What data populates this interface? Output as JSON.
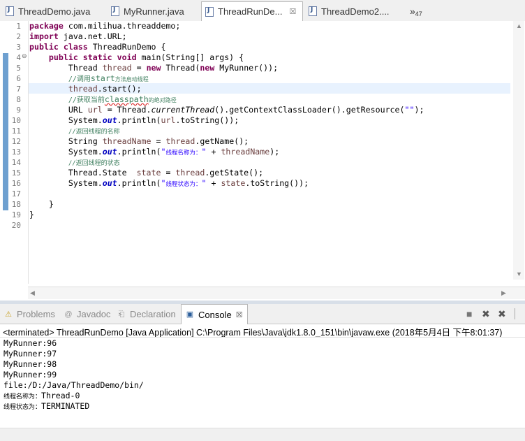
{
  "editor_tabs": [
    {
      "label": "ThreadDemo.java"
    },
    {
      "label": "MyRunner.java"
    },
    {
      "label": "ThreadRunDe...",
      "close": "☒"
    },
    {
      "label": "ThreadDemo2...."
    }
  ],
  "overflow": {
    "chevron": "»",
    "count": "47"
  },
  "line_numbers": [
    "1",
    "2",
    "3",
    "4",
    "5",
    "6",
    "7",
    "8",
    "9",
    "10",
    "11",
    "12",
    "13",
    "14",
    "15",
    "16",
    "17",
    "18",
    "19",
    "20"
  ],
  "fold_markers": {
    "line4": "⊖"
  },
  "code": {
    "l1": {
      "kw": "package",
      "rest": " com.milihua.threaddemo;"
    },
    "l2": {
      "kw": "import",
      "rest": " java.net.URL;"
    },
    "l3": {
      "kw": "public class",
      "rest": " ThreadRunDemo {"
    },
    "l4": {
      "indent": "    ",
      "kw": "public static void",
      "rest": " main(String[] args) {"
    },
    "l5": {
      "indent": "        ",
      "a": "Thread ",
      "v": "thread",
      "b": " = ",
      "kw": "new",
      "c": " Thread(",
      "kw2": "new",
      "d": " MyRunner());"
    },
    "l6": {
      "indent": "        ",
      "cmt_a": "//调用",
      "cmt_b": "start",
      "cmt_c": "方法启动线程"
    },
    "l7": {
      "indent": "        ",
      "v": "thread",
      "rest": ".start();"
    },
    "l8": {
      "indent": "        ",
      "cmt_a": "//获取当前",
      "cmt_b": "classpath",
      "cmt_c": "的绝对路径"
    },
    "l9": {
      "indent": "        ",
      "a": "URL ",
      "v": "url",
      "b": " = Thread.",
      "it": "currentThread",
      "c": "().getContextClassLoader().getResource(",
      "str": "\"\"",
      "d": ");"
    },
    "l10": {
      "indent": "        ",
      "a": "System.",
      "fld": "out",
      "b": ".println(",
      "v": "url",
      "c": ".toString());"
    },
    "l11": {
      "indent": "        ",
      "cmt_a": "//返回线程的名称"
    },
    "l12": {
      "indent": "        ",
      "a": "String ",
      "v": "threadName",
      "b": " = ",
      "v2": "thread",
      "c": ".getName();"
    },
    "l13": {
      "indent": "        ",
      "a": "System.",
      "fld": "out",
      "b": ".println(",
      "str_a": "\"",
      "str_cjk": "线程名称为：",
      "str_b": "\"",
      "c": " + ",
      "v": "threadName",
      "d": ");"
    },
    "l14": {
      "indent": "        ",
      "cmt_a": "//返回线程的状态"
    },
    "l15": {
      "indent": "        ",
      "a": "Thread.State  ",
      "v": "state",
      "b": " = ",
      "v2": "thread",
      "c": ".getState();"
    },
    "l16": {
      "indent": "        ",
      "a": "System.",
      "fld": "out",
      "b": ".println(",
      "str_a": "\"",
      "str_cjk": "线程状态为：",
      "str_b": "\"",
      "c": " + ",
      "v": "state",
      "d": ".toString());"
    },
    "l17": {
      "text": ""
    },
    "l18": {
      "text": "    }"
    },
    "l19": {
      "text": "}"
    },
    "l20": {
      "text": ""
    }
  },
  "scroll": {
    "up": "▲",
    "down": "▼",
    "left": "◀",
    "right": "▶"
  },
  "views": {
    "problems": "Problems",
    "javadoc": "Javadoc",
    "declaration": "Declaration",
    "console": "Console",
    "console_close": "☒"
  },
  "view_icons": {
    "problems": "⚠",
    "javadoc": "@",
    "declaration": "⎗",
    "console": "▣"
  },
  "toolbar": {
    "terminate": "■",
    "remove": "✖",
    "remove_all": "✖"
  },
  "console": {
    "status": "<terminated> ThreadRunDemo [Java Application] C:\\Program Files\\Java\\jdk1.8.0_151\\bin\\javaw.exe (2018年5月4日 下午8:01:37)",
    "lines": [
      "MyRunner:96",
      "MyRunner:97",
      "MyRunner:98",
      "MyRunner:99",
      "file:/D:/Java/ThreadDemo/bin/"
    ],
    "name_prefix": "线程名称为：",
    "name_value": "Thread-0",
    "state_prefix": "线程状态为：",
    "state_value": "TERMINATED"
  },
  "colors": {
    "keyword": "#7f0055",
    "variable": "#6a3e3e",
    "field": "#0000c0",
    "string": "#2a00ff",
    "comment": "#3f7f5f"
  }
}
